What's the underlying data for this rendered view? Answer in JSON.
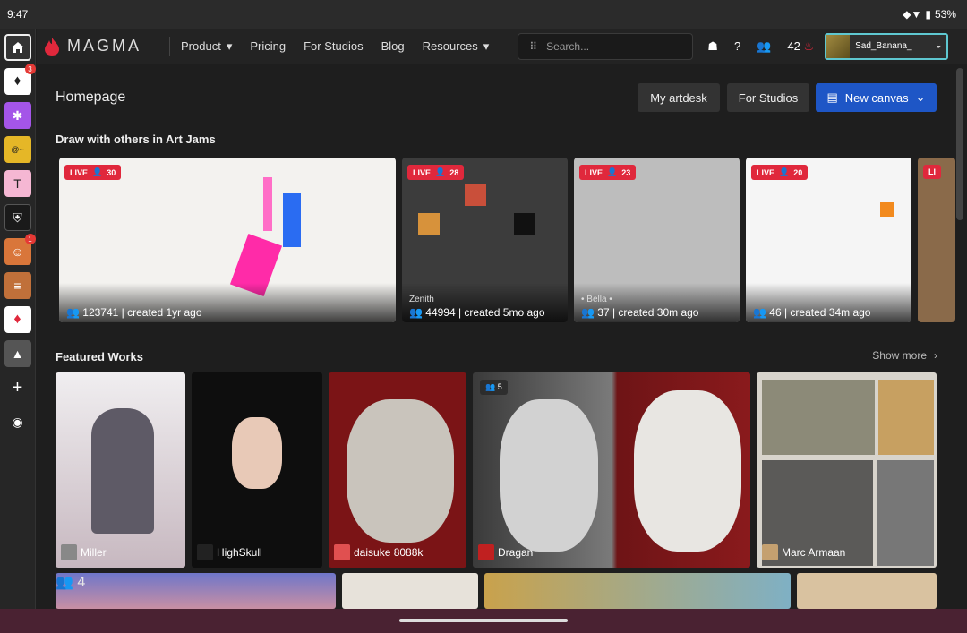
{
  "status": {
    "time": "9:47",
    "battery": "53%"
  },
  "sidebar": {
    "badges": [
      "3",
      "1"
    ]
  },
  "nav": {
    "brand": "MAGMA",
    "links": [
      "Product",
      "Pricing",
      "For Studios",
      "Blog",
      "Resources"
    ],
    "search_placeholder": "Search...",
    "embers": "42",
    "username": "Sad_Banana_"
  },
  "page": {
    "title": "Homepage",
    "btn_artdesk": "My artdesk",
    "btn_studios": "For Studios",
    "btn_new": "New canvas"
  },
  "artjams": {
    "title": "Draw with others in Art Jams",
    "items": [
      {
        "live": "LIVE",
        "count": "30",
        "host": "",
        "meta": "123741 | created 1yr ago"
      },
      {
        "live": "LIVE",
        "count": "28",
        "host": "Zenith",
        "meta": "44994 | created 5mo ago"
      },
      {
        "live": "LIVE",
        "count": "23",
        "host": "• Bella •",
        "meta": "37 | created 30m ago"
      },
      {
        "live": "LIVE",
        "count": "20",
        "host": "",
        "meta": "46 | created 34m ago"
      },
      {
        "live": "LI",
        "count": "",
        "host": "",
        "meta": ""
      }
    ]
  },
  "featured": {
    "title": "Featured Works",
    "show_more": "Show more",
    "items": [
      {
        "author": "Miller",
        "count": ""
      },
      {
        "author": "HighSkull",
        "count": ""
      },
      {
        "author": "daisuke 8088k",
        "count": ""
      },
      {
        "author": "Dragan",
        "count": "5"
      },
      {
        "author": "Marc Armaan",
        "count": ""
      }
    ],
    "row2_count": "4"
  }
}
